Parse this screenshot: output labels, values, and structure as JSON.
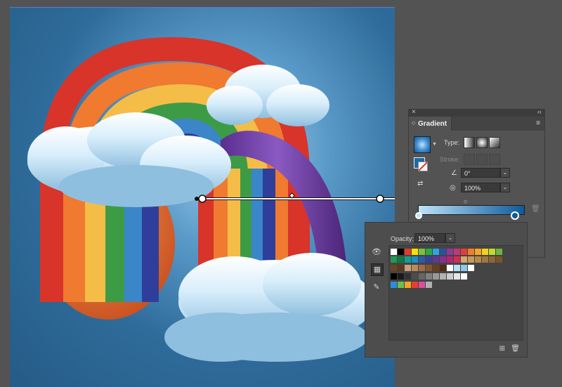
{
  "gradient_panel": {
    "title": "Gradient",
    "close_glyph": "×",
    "collapse_glyph": "‹‹",
    "menu_glyph": "≡",
    "type_label": "Type:",
    "stroke_label": "Stroke:",
    "angle_icon": "angle-icon",
    "angle_value": "0°",
    "aspect_icon": "aspect-ratio-icon",
    "aspect_value": "100%",
    "start_color": "#bfe3fa",
    "end_color": "#0e5a9a",
    "delete_stop_glyph": "🗑"
  },
  "swatches_panel": {
    "opacity_label": "Opacity:",
    "opacity_value": "100%",
    "rows": [
      [
        "#ffffff",
        "#000000",
        "#e03a2b",
        "#f6e200",
        "#7fbf3f",
        "#2ba84a",
        "#28a8e0",
        "#2e4ea0",
        "#8d3b97",
        "#c0377b",
        "#e63c37",
        "#f07f2a",
        "#f5a623",
        "#f7d117",
        "#c4d82d",
        "#6cb33f"
      ],
      [
        "#1f9b57",
        "#0f7a44",
        "#119f91",
        "#1a8fc9",
        "#2c5aa8",
        "#3b3f99",
        "#5e3892",
        "#8a2f8f",
        "#b3266e",
        "#d12d55",
        "#d4a86f",
        "#c59a5f",
        "#b28a50",
        "#a07842",
        "#8d6636",
        "#7a542b"
      ],
      [
        "#6b4623",
        "#593a1c",
        "#caa07a",
        "#b98a5f",
        "#9d6e43",
        "#83552e",
        "#6a3f1f",
        "#4f2c12",
        "#ffffff",
        "#b8e0f7",
        "#90c7ec",
        "#ffffff"
      ],
      [
        "#000000",
        "#1a1a1a",
        "#333333",
        "#4d4d4d",
        "#666666",
        "#808080",
        "#999999",
        "#b3b3b3",
        "#cccccc",
        "#e6e6e6",
        "#ffffff"
      ],
      [
        "#2e8be0",
        "#6cc04a",
        "#f3a623",
        "#e53f2e",
        "#d94f9c",
        "#b0b0b0"
      ]
    ],
    "new_swatch_glyph": "⊞",
    "delete_swatch_glyph": "🗑"
  }
}
